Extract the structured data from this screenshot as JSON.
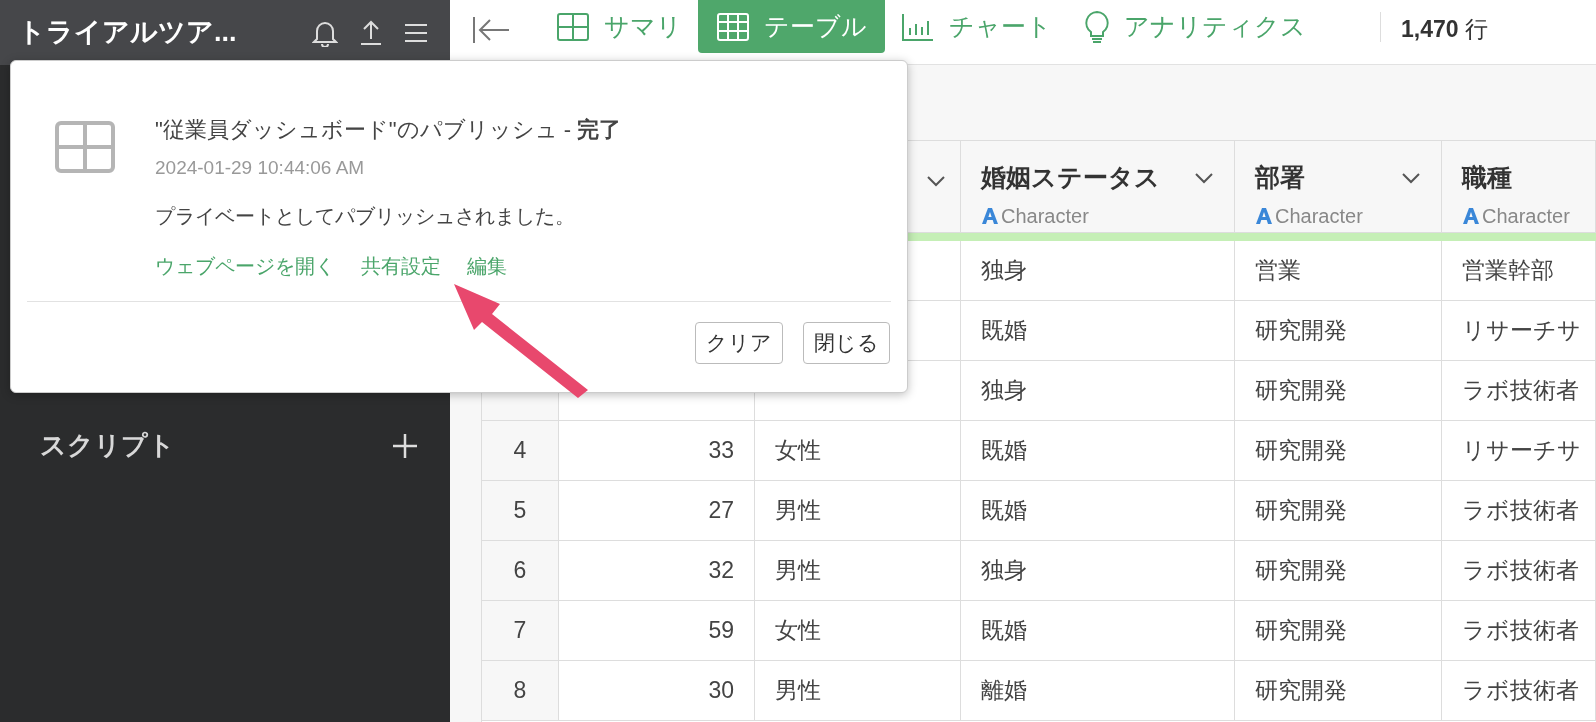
{
  "sidebar": {
    "project_title": "トライアルツア...",
    "section": {
      "label": "スクリプト"
    }
  },
  "tabs": [
    {
      "label": "サマリ",
      "kind": "summary",
      "selected": false
    },
    {
      "label": "テーブル",
      "kind": "table",
      "selected": true
    },
    {
      "label": "チャート",
      "kind": "chart",
      "selected": false
    },
    {
      "label": "アナリティクス",
      "kind": "analytics",
      "selected": false
    }
  ],
  "row_count": "**1,470** 行",
  "notification": {
    "title": "\"従業員ダッシュボード\"のパブリッシュ - **完了**",
    "timestamp": "2024-01-29 10:44:06 AM",
    "message": "プライベートとしてパブリッシュされました。",
    "links": [
      "ウェブページを開く",
      "共有設定",
      "編集"
    ],
    "buttons": [
      "クリア",
      "閉じる"
    ]
  },
  "table": {
    "columns": [
      {
        "name": "婚姻ステータス",
        "type": "Character"
      },
      {
        "name": "部署",
        "type": "Character"
      },
      {
        "name": "職種",
        "type": "Character"
      }
    ],
    "rows": [
      {
        "cells": [
          "独身",
          "営業",
          "営業幹部"
        ]
      },
      {
        "cells": [
          "既婚",
          "研究開発",
          "リサーチサ"
        ]
      },
      {
        "cells": [
          "独身",
          "研究開発",
          "ラボ技術者"
        ]
      },
      {
        "number": "4",
        "age": "33",
        "gender": "女性",
        "cells": [
          "既婚",
          "研究開発",
          "リサーチサ"
        ]
      },
      {
        "number": "5",
        "age": "27",
        "gender": "男性",
        "cells": [
          "既婚",
          "研究開発",
          "ラボ技術者"
        ]
      },
      {
        "number": "6",
        "age": "32",
        "gender": "男性",
        "cells": [
          "独身",
          "研究開発",
          "ラボ技術者"
        ]
      },
      {
        "number": "7",
        "age": "59",
        "gender": "女性",
        "cells": [
          "既婚",
          "研究開発",
          "ラボ技術者"
        ]
      },
      {
        "number": "8",
        "age": "30",
        "gender": "男性",
        "cells": [
          "離婚",
          "研究開発",
          "ラボ技術者"
        ]
      }
    ]
  }
}
